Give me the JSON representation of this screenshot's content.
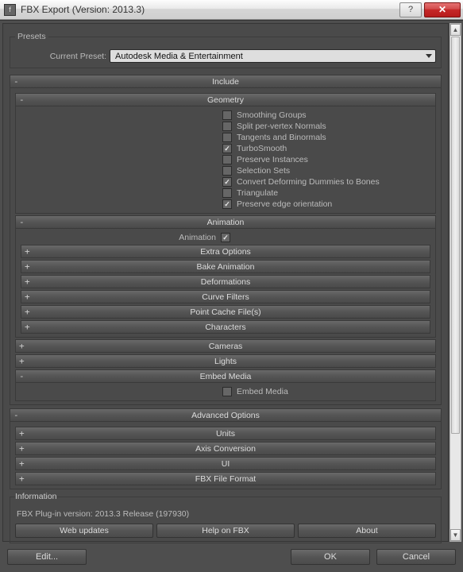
{
  "window": {
    "title": "FBX Export (Version: 2013.3)"
  },
  "presets": {
    "legend": "Presets",
    "label": "Current Preset:",
    "value": "Autodesk Media & Entertainment"
  },
  "sections": {
    "include": {
      "title": "Include",
      "sign": "-"
    },
    "geometry": {
      "title": "Geometry",
      "sign": "-"
    },
    "animation": {
      "title": "Animation",
      "sign": "-"
    },
    "cameras": {
      "title": "Cameras",
      "sign": "+"
    },
    "lights": {
      "title": "Lights",
      "sign": "+"
    },
    "embed": {
      "title": "Embed Media",
      "sign": "-"
    },
    "advanced": {
      "title": "Advanced Options",
      "sign": "-"
    },
    "units": {
      "title": "Units",
      "sign": "+"
    },
    "axis": {
      "title": "Axis Conversion",
      "sign": "+"
    },
    "ui": {
      "title": "UI",
      "sign": "+"
    },
    "fbxfmt": {
      "title": "FBX File Format",
      "sign": "+"
    },
    "extra": {
      "title": "Extra Options",
      "sign": "+"
    },
    "bake": {
      "title": "Bake Animation",
      "sign": "+"
    },
    "deform": {
      "title": "Deformations",
      "sign": "+"
    },
    "curve": {
      "title": "Curve Filters",
      "sign": "+"
    },
    "pcache": {
      "title": "Point Cache File(s)",
      "sign": "+"
    },
    "chars": {
      "title": "Characters",
      "sign": "+"
    }
  },
  "geom_opts": {
    "smoothing": "Smoothing Groups",
    "split": "Split per-vertex Normals",
    "tangents": "Tangents and Binormals",
    "turbo": "TurboSmooth",
    "preserve_inst": "Preserve Instances",
    "selection": "Selection Sets",
    "convert_dummies": "Convert Deforming Dummies to Bones",
    "triangulate": "Triangulate",
    "preserve_edge": "Preserve edge orientation"
  },
  "anim": {
    "label": "Animation"
  },
  "embed": {
    "label": "Embed Media"
  },
  "info": {
    "legend": "Information",
    "plugin": "FBX Plug-in version: 2013.3 Release (197930)",
    "web": "Web updates",
    "help": "Help on FBX",
    "about": "About"
  },
  "bottom": {
    "edit": "Edit...",
    "ok": "OK",
    "cancel": "Cancel"
  }
}
